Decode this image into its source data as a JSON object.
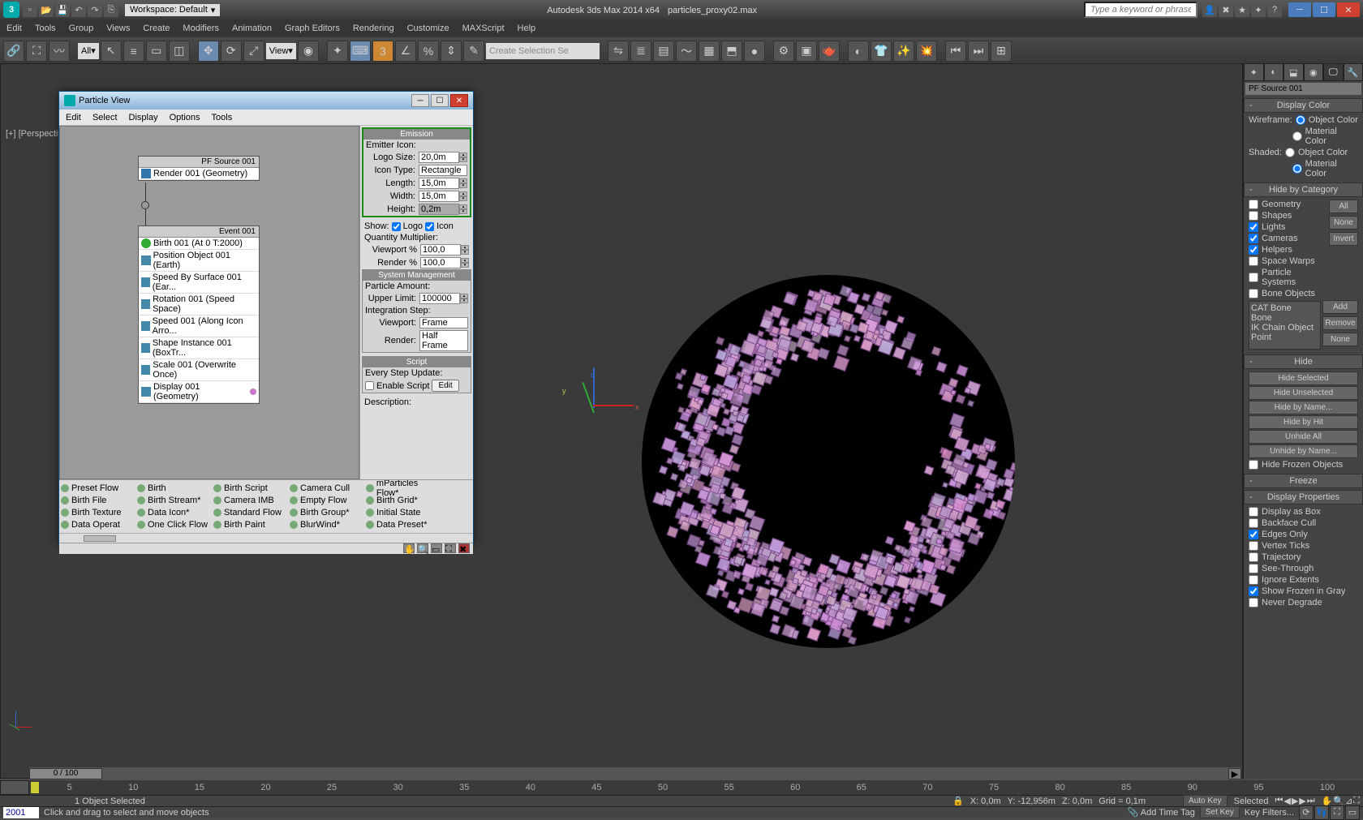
{
  "app": {
    "title_left": "Autodesk 3ds Max 2014 x64",
    "title_file": "particles_proxy02.max",
    "workspace_label": "Workspace: Default",
    "search_placeholder": "Type a keyword or phrase"
  },
  "menubar": [
    "Edit",
    "Tools",
    "Group",
    "Views",
    "Create",
    "Modifiers",
    "Animation",
    "Graph Editors",
    "Rendering",
    "Customize",
    "MAXScript",
    "Help"
  ],
  "maintb": {
    "selset_placeholder": "Create Selection Se",
    "filter": "All",
    "refcoord": "View",
    "snap_num": "3"
  },
  "viewport": {
    "label": "[+] [Perspective ] [Realistic ]"
  },
  "pv": {
    "title": "Particle View",
    "menu": [
      "Edit",
      "Select",
      "Display",
      "Options",
      "Tools"
    ],
    "global": {
      "header": "PF Source 001",
      "rows": [
        "Render 001 (Geometry)"
      ]
    },
    "event": {
      "header": "Event 001",
      "rows": [
        "Birth 001 (At 0 T:2000)",
        "Position Object 001 (Earth)",
        "Speed By Surface 001 (Ear...",
        "Rotation 001 (Speed Space)",
        "Speed 001 (Along Icon Arro...",
        "Shape Instance 001 (BoxTr...",
        "Scale 001 (Overwrite Once)",
        "Display 001 (Geometry)"
      ]
    },
    "depot": [
      "Preset Flow",
      "Birth",
      "Birth Script",
      "Camera Cull",
      "mParticles Flow*",
      "Birth File",
      "Birth Stream*",
      "Camera IMB",
      "Empty Flow",
      "Birth Grid*",
      "Birth Texture",
      "Data Icon*",
      "Standard Flow",
      "Birth Group*",
      "Initial State",
      "Data Operat",
      "One Click Flow",
      "Birth Paint",
      "BlurWind*",
      "Data Preset*"
    ],
    "props": {
      "emission_hdr": "Emission",
      "emitter_icon_lbl": "Emitter Icon:",
      "logo_size_lbl": "Logo Size:",
      "logo_size": "20,0m",
      "icon_type_lbl": "Icon Type:",
      "icon_type": "Rectangle",
      "length_lbl": "Length:",
      "length": "15,0m",
      "width_lbl": "Width:",
      "width": "15,0m",
      "height_lbl": "Height:",
      "height": "0,2m",
      "show_lbl": "Show:",
      "show_logo": "Logo",
      "show_icon": "Icon",
      "qty_lbl": "Quantity Multiplier:",
      "vp_lbl": "Viewport %",
      "vp_val": "100,0",
      "rd_lbl": "Render %",
      "rd_val": "100,0",
      "sys_hdr": "System Management",
      "amount_lbl": "Particle Amount:",
      "upper_lbl": "Upper Limit:",
      "upper_val": "100000",
      "integ_lbl": "Integration Step:",
      "ivp_lbl": "Viewport:",
      "ivp_val": "Frame",
      "ird_lbl": "Render:",
      "ird_val": "Half Frame",
      "script_hdr": "Script",
      "every_lbl": "Every Step Update:",
      "enable_lbl": "Enable Script",
      "edit_btn": "Edit",
      "desc_lbl": "Description:"
    }
  },
  "cmd": {
    "name": "PF Source 001",
    "display_color_hdr": "Display Color",
    "wireframe_lbl": "Wireframe:",
    "shaded_lbl": "Shaded:",
    "obj_color": "Object Color",
    "mtl_color": "Material Color",
    "hide_cat_hdr": "Hide by Category",
    "cats": [
      "Geometry",
      "Shapes",
      "Lights",
      "Cameras",
      "Helpers",
      "Space Warps",
      "Particle Systems",
      "Bone Objects"
    ],
    "cat_checked": [
      false,
      false,
      true,
      true,
      true,
      false,
      false,
      false
    ],
    "all": "All",
    "none": "None",
    "invert": "Invert",
    "bone_list": [
      "CAT Bone",
      "Bone",
      "IK Chain Object",
      "Point"
    ],
    "add": "Add",
    "remove": "Remove",
    "none2": "None",
    "hide_hdr": "Hide",
    "hide_btns": [
      "Hide Selected",
      "Hide Unselected",
      "Hide by Name...",
      "Hide by Hit",
      "Unhide All",
      "Unhide by Name..."
    ],
    "hide_frozen": "Hide Frozen Objects",
    "freeze_hdr": "Freeze",
    "disp_prop_hdr": "Display Properties",
    "disp_props": [
      "Display as Box",
      "Backface Cull",
      "Edges Only",
      "Vertex Ticks",
      "Trajectory",
      "See-Through",
      "Ignore Extents",
      "Show Frozen in Gray",
      "Never Degrade"
    ],
    "disp_checked": [
      false,
      false,
      true,
      false,
      false,
      false,
      false,
      true,
      false
    ]
  },
  "time": {
    "slider": "0 / 100",
    "ticks": [
      "5",
      "10",
      "15",
      "20",
      "25",
      "30",
      "35",
      "40",
      "45",
      "50",
      "55",
      "60",
      "65",
      "70",
      "75",
      "80",
      "85",
      "90",
      "95",
      "100"
    ]
  },
  "status": {
    "frame": "2001",
    "sel": "1 Object Selected",
    "prompt": "Click and drag to select and move objects",
    "x": "X: 0,0m",
    "y": "Y: -12,956m",
    "z": "Z: 0,0m",
    "grid": "Grid = 0,1m",
    "autokey": "Auto Key",
    "setkey": "Set Key",
    "filter": "Selected",
    "keyfilters": "Key Filters...",
    "addtag": "Add Time Tag"
  }
}
